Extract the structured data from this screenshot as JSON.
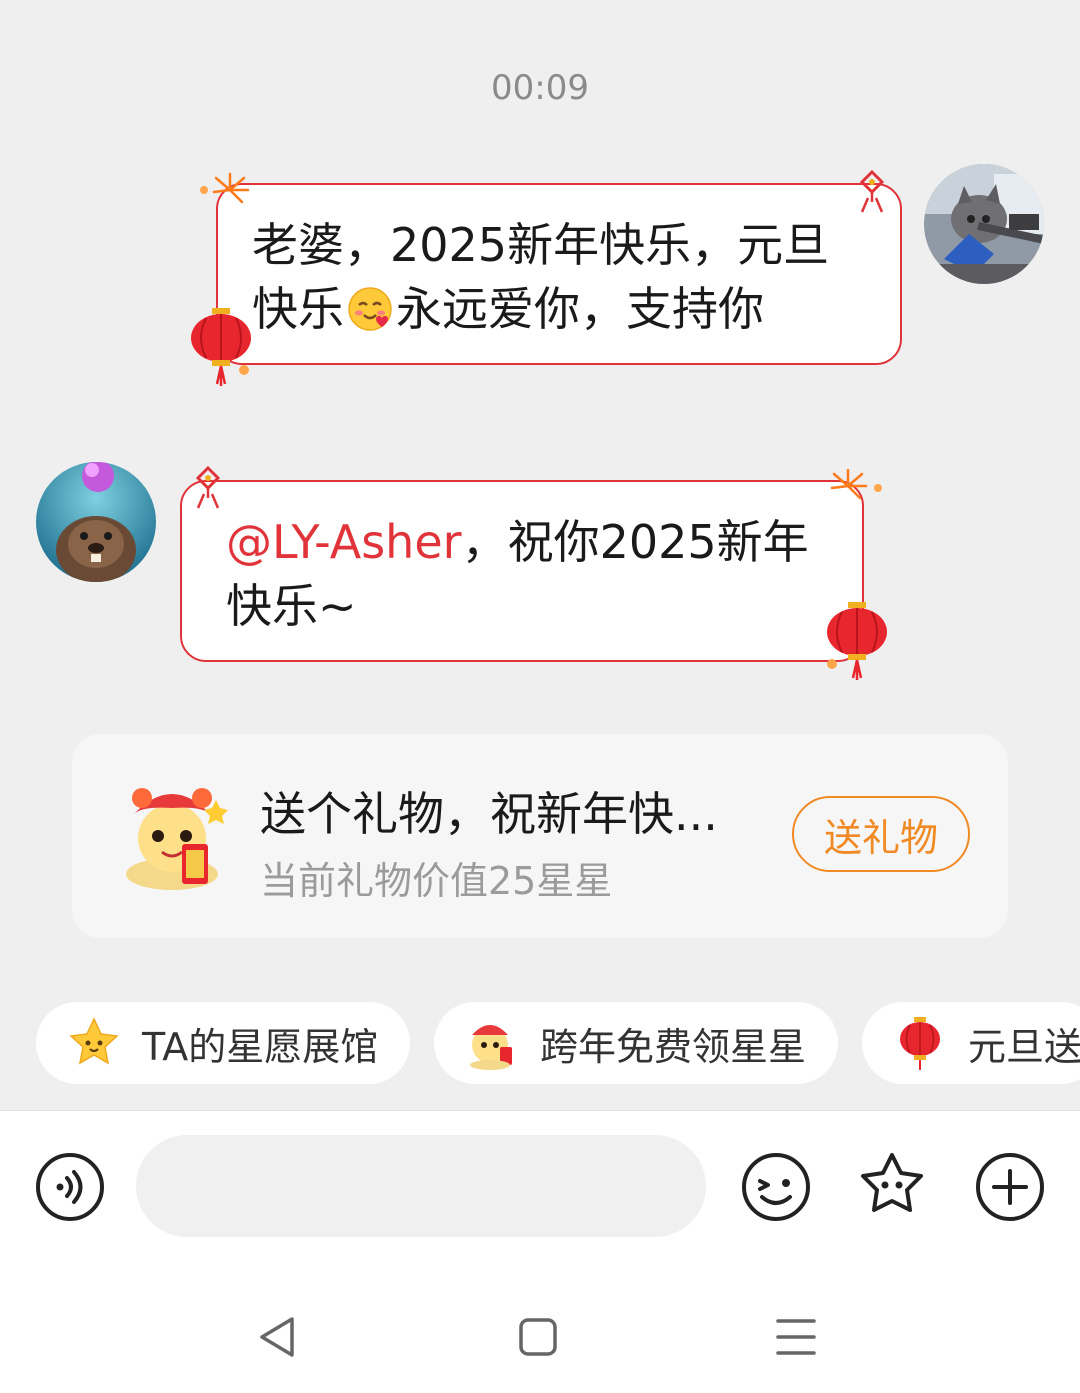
{
  "timestamp": "00:09",
  "messages": [
    {
      "side": "right",
      "line1": "老婆，2025新年快乐，元旦",
      "line2_a": "快乐",
      "line2_b": "永远爱你，支持你",
      "emoji": "blushing-face-with-hearts"
    },
    {
      "side": "left",
      "mention": "@LY-Asher",
      "line1_rest": "，祝你2025新年",
      "line2": "快乐~"
    }
  ],
  "gift_card": {
    "title": "送个礼物，祝新年快...",
    "subtitle": "当前礼物价值25星星",
    "button": "送礼物",
    "icon": "lion-dance-mascot-icon"
  },
  "chips": [
    {
      "label": "TA的星愿展馆",
      "icon": "star-face-icon"
    },
    {
      "label": "跨年免费领星星",
      "icon": "lion-dance-mascot-icon"
    },
    {
      "label": "元旦送",
      "icon": "red-lantern-icon"
    }
  ],
  "input": {
    "placeholder": ""
  },
  "colors": {
    "accent_red": "#e0343a",
    "gift_orange": "#f08a24",
    "background": "#efefef"
  }
}
